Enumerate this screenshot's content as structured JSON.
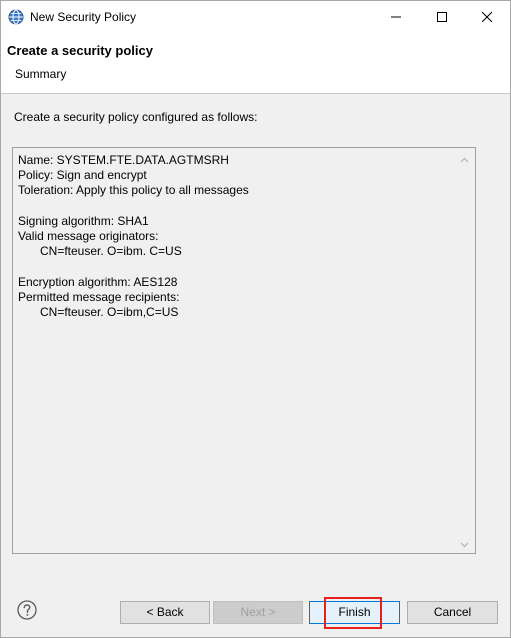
{
  "window": {
    "title": "New Security Policy"
  },
  "header": {
    "title": "Create a security policy",
    "subtitle": "Summary"
  },
  "instruction": "Create a security policy configured as follows:",
  "summary": {
    "lines": [
      {
        "text": "Name: SYSTEM.FTE.DATA.AGTMSRH",
        "indent": false
      },
      {
        "text": "Policy: Sign and encrypt",
        "indent": false
      },
      {
        "text": "Toleration: Apply this policy to all messages",
        "indent": false
      },
      {
        "text": "",
        "indent": false
      },
      {
        "text": "Signing algorithm: SHA1",
        "indent": false
      },
      {
        "text": "Valid message originators:",
        "indent": false
      },
      {
        "text": "CN=fteuser. O=ibm. C=US",
        "indent": true
      },
      {
        "text": "",
        "indent": false
      },
      {
        "text": "Encryption algorithm: AES128",
        "indent": false
      },
      {
        "text": "Permitted message recipients:",
        "indent": false
      },
      {
        "text": "CN=fteuser. O=ibm,C=US",
        "indent": true
      }
    ]
  },
  "buttons": {
    "back": "< Back",
    "next": "Next >",
    "finish": "Finish",
    "cancel": "Cancel"
  },
  "icons": {
    "app": "globe-icon",
    "help": "help-icon",
    "minimize": "minimize-icon",
    "maximize": "maximize-icon",
    "close": "close-icon"
  },
  "colors": {
    "highlight": "#e8201a",
    "default_button_border": "#0078d7"
  }
}
